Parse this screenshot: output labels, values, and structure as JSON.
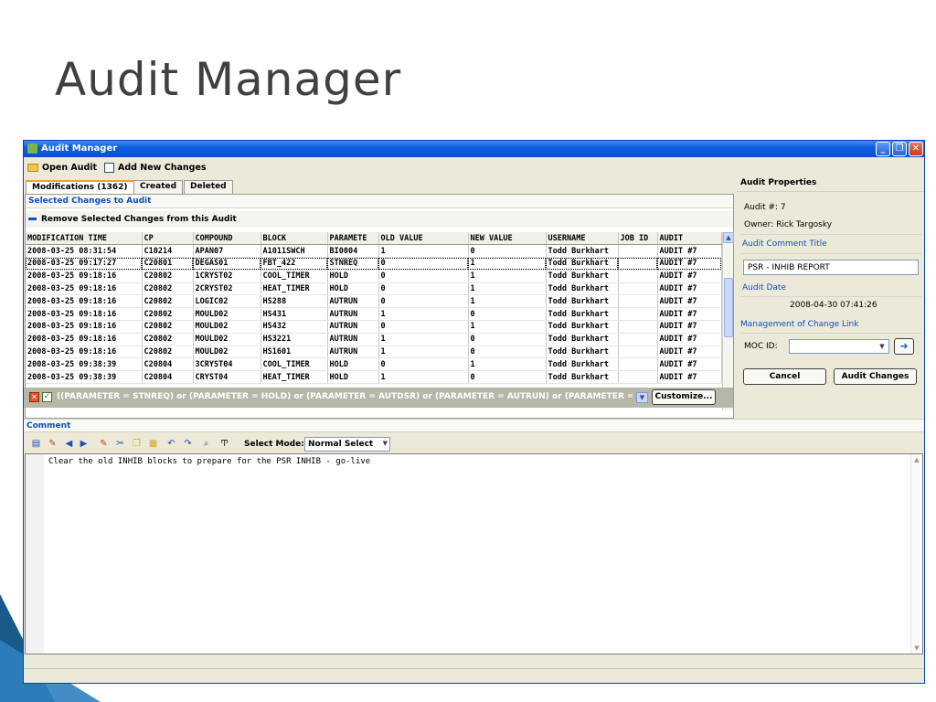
{
  "slide": {
    "title": "Audit Manager"
  },
  "window": {
    "title": "Audit Manager",
    "controls": [
      "minimize-icon",
      "restore-icon",
      "close-icon"
    ]
  },
  "toolbar": {
    "open_audit": "Open Audit",
    "add_new_changes": "Add New Changes"
  },
  "tabs": [
    {
      "label": "Modifications (1362)",
      "active": true
    },
    {
      "label": "Created",
      "active": false
    },
    {
      "label": "Deleted",
      "active": false
    }
  ],
  "left": {
    "section_title": "Selected Changes to Audit",
    "remove_label": "Remove Selected Changes from this Audit"
  },
  "table": {
    "columns": [
      "MODIFICATION TIME",
      "CP",
      "COMPOUND",
      "BLOCK",
      "PARAMETE",
      "OLD VALUE",
      "NEW VALUE",
      "USERNAME",
      "JOB ID",
      "AUDIT"
    ],
    "rows": [
      [
        "2008-03-25 08:31:54",
        "C10214",
        "APAN07",
        "A1011SWCH",
        "BI0004",
        "1",
        "0",
        "Todd Burkhart",
        "",
        "AUDIT #7"
      ],
      [
        "2008-03-25 09:17:27",
        "C20801",
        "DEGAS01",
        "FBT_422",
        "STNREQ",
        "0",
        "1",
        "Todd Burkhart",
        "",
        "AUDIT #7"
      ],
      [
        "2008-03-25 09:18:16",
        "C20802",
        "1CRYST02",
        "COOL_TIMER",
        "HOLD",
        "0",
        "1",
        "Todd Burkhart",
        "",
        "AUDIT #7"
      ],
      [
        "2008-03-25 09:18:16",
        "C20802",
        "2CRYST02",
        "HEAT_TIMER",
        "HOLD",
        "0",
        "1",
        "Todd Burkhart",
        "",
        "AUDIT #7"
      ],
      [
        "2008-03-25 09:18:16",
        "C20802",
        "LOGIC02",
        "HS288",
        "AUTRUN",
        "0",
        "1",
        "Todd Burkhart",
        "",
        "AUDIT #7"
      ],
      [
        "2008-03-25 09:18:16",
        "C20802",
        "MOULD02",
        "HS431",
        "AUTRUN",
        "1",
        "0",
        "Todd Burkhart",
        "",
        "AUDIT #7"
      ],
      [
        "2008-03-25 09:18:16",
        "C20802",
        "MOULD02",
        "HS432",
        "AUTRUN",
        "0",
        "1",
        "Todd Burkhart",
        "",
        "AUDIT #7"
      ],
      [
        "2008-03-25 09:18:16",
        "C20802",
        "MOULD02",
        "HS3221",
        "AUTRUN",
        "1",
        "0",
        "Todd Burkhart",
        "",
        "AUDIT #7"
      ],
      [
        "2008-03-25 09:18:16",
        "C20802",
        "MOULD02",
        "HS1601",
        "AUTRUN",
        "1",
        "0",
        "Todd Burkhart",
        "",
        "AUDIT #7"
      ],
      [
        "2008-03-25 09:38:39",
        "C20804",
        "3CRYST04",
        "COOL_TIMER",
        "HOLD",
        "0",
        "1",
        "Todd Burkhart",
        "",
        "AUDIT #7"
      ],
      [
        "2008-03-25 09:38:39",
        "C20804",
        "CRYST04",
        "HEAT_TIMER",
        "HOLD",
        "1",
        "0",
        "Todd Burkhart",
        "",
        "AUDIT #7"
      ]
    ],
    "selected_row": 1
  },
  "filter": {
    "text": "((PARAMETER = STNREQ) or (PARAMETER = HOLD) or (PARAMETER = AUTDSR) or (PARAMETER = AUTRUN) or (PARAMETER = BI",
    "customize_label": "Customize..."
  },
  "properties": {
    "title": "Audit Properties",
    "audit_number": "Audit #: 7",
    "owner": "Owner: Rick Targosky",
    "comment_title_label": "Audit Comment Title",
    "comment_title_value": "PSR - INHIB REPORT",
    "audit_date_label": "Audit Date",
    "audit_date_value": "2008-04-30 07:41:26",
    "moc_label": "Management of Change Link",
    "moc_id_label": "MOC ID:",
    "moc_id_value": "",
    "cancel_label": "Cancel",
    "audit_changes_label": "Audit Changes"
  },
  "comment": {
    "title": "Comment",
    "select_mode_label": "Select Mode:",
    "select_mode_value": "Normal Select",
    "text": "Clear the old INHIB blocks to prepare for the PSR INHIB - go-live"
  },
  "colors": {
    "titlebar": "#0d5ee0",
    "link_blue": "#0b4fc0",
    "filter_bar": "#b7b7a8",
    "window_bg": "#ece9d8"
  }
}
